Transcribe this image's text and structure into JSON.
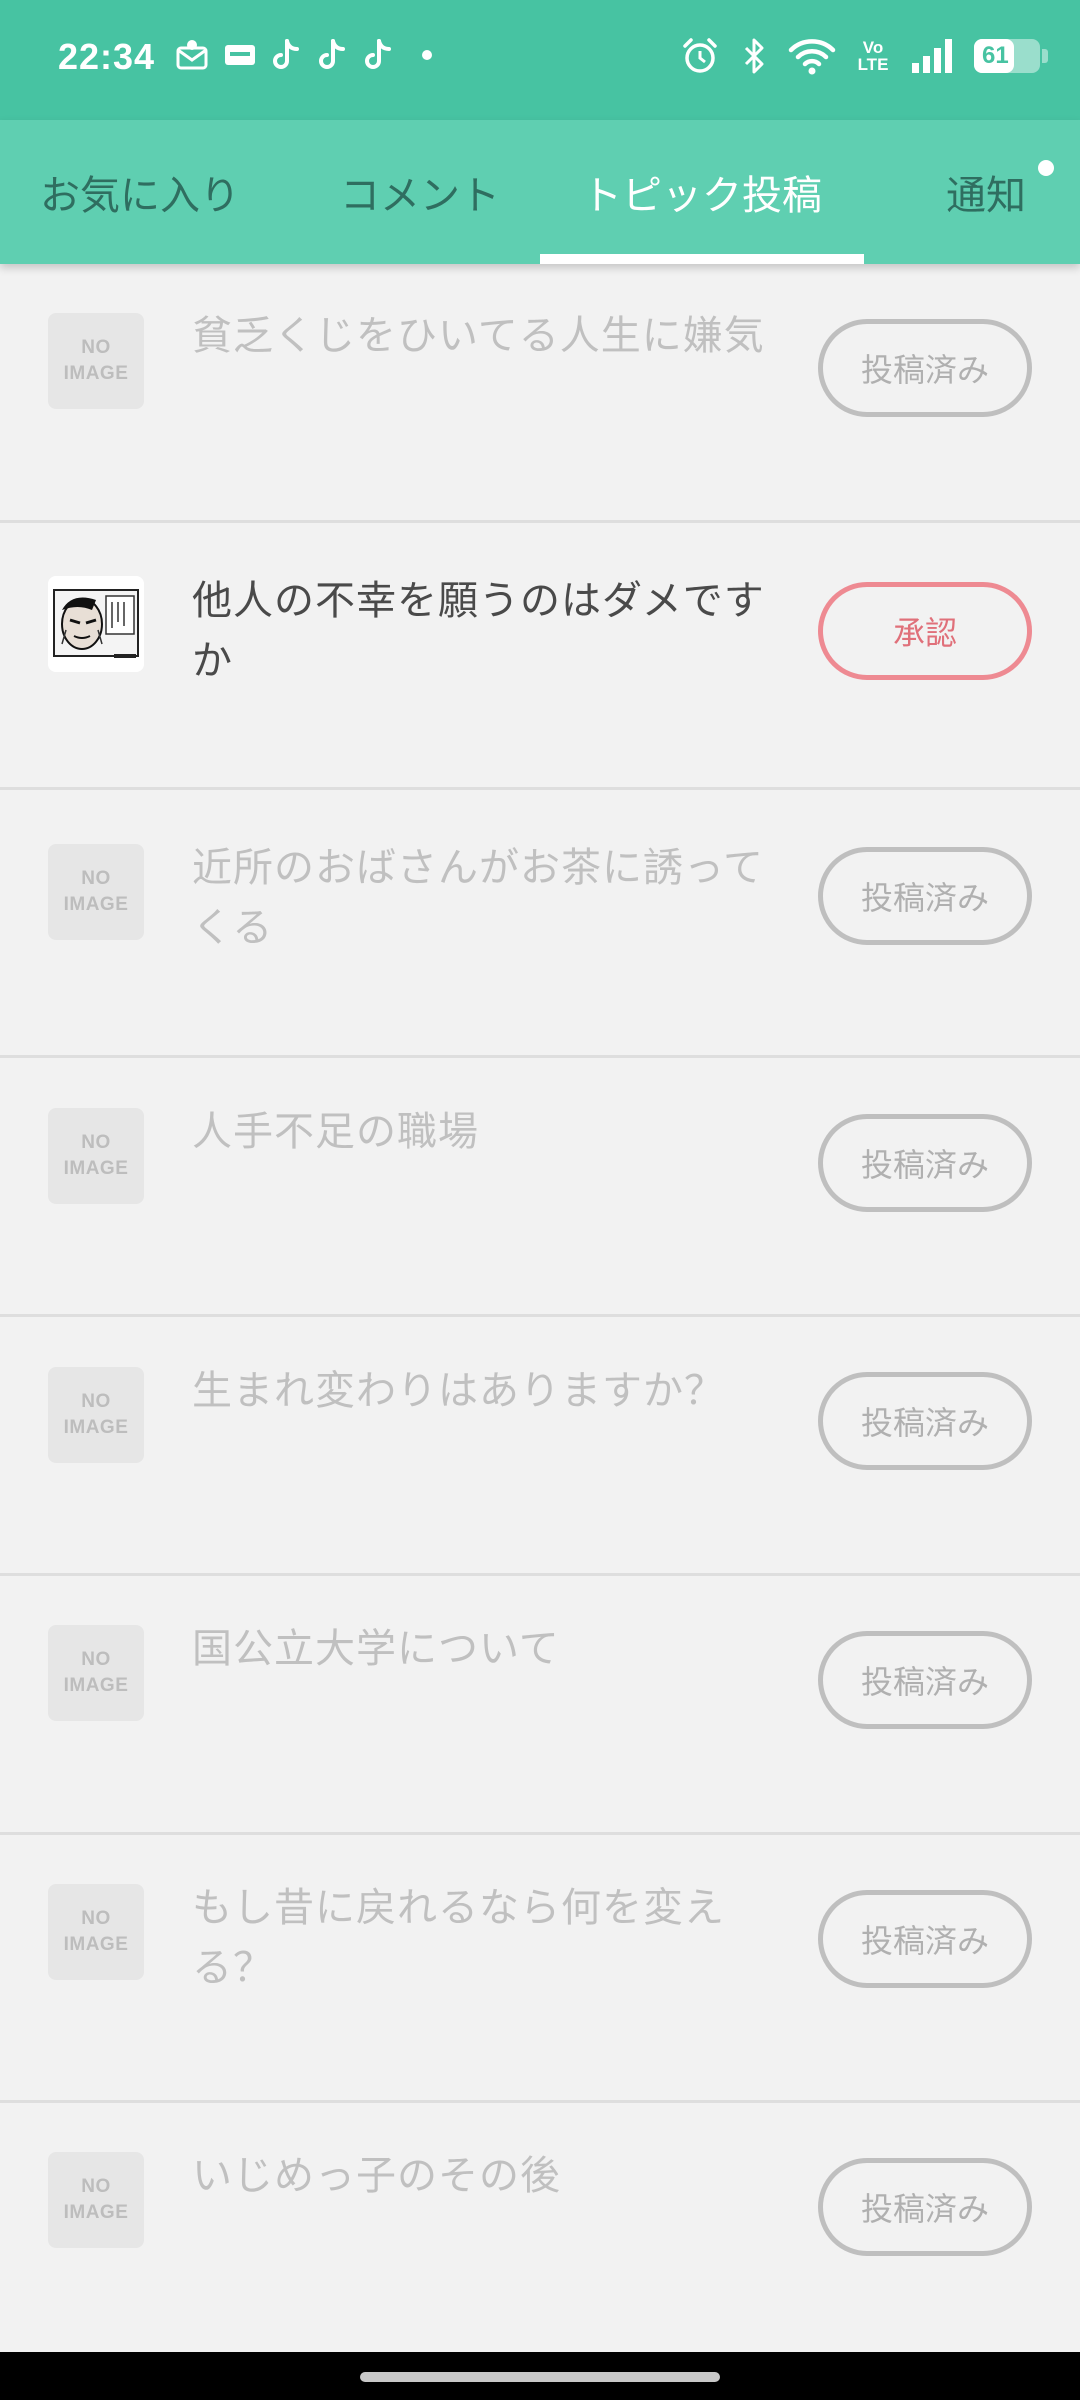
{
  "status_bar": {
    "time": "22:34",
    "notification_icons": [
      "mail-icon",
      "ticket-icon",
      "tiktok-icon",
      "tiktok-icon",
      "tiktok-icon",
      "dot-icon"
    ],
    "system_icons": [
      "alarm-icon",
      "bluetooth-icon",
      "wifi-icon",
      "volte-icon",
      "signal-icon"
    ],
    "volte_text": "Vo LTE",
    "battery_level": "61",
    "battery_fraction": 0.61
  },
  "tabs": [
    {
      "label": "お気に入り",
      "active": false
    },
    {
      "label": "コメント",
      "active": false
    },
    {
      "label": "トピック投稿",
      "active": true
    },
    {
      "label": "通知",
      "active": false,
      "badge_dot": true
    }
  ],
  "no_image": {
    "line1": "NO",
    "line2": "IMAGE"
  },
  "topics": [
    {
      "title": "貧乏くじをひいてる人生に嫌気",
      "status": "投稿済み",
      "thumbnail": "no-image"
    },
    {
      "title": "他人の不幸を願うのはダメですか",
      "status": "承認",
      "thumbnail": "manga-image"
    },
    {
      "title": "近所のおばさんがお茶に誘ってくる",
      "status": "投稿済み",
      "thumbnail": "no-image"
    },
    {
      "title": "人手不足の職場",
      "status": "投稿済み",
      "thumbnail": "no-image"
    },
    {
      "title": "生まれ変わりはありますか？",
      "status": "投稿済み",
      "thumbnail": "no-image"
    },
    {
      "title": "国公立大学について",
      "status": "投稿済み",
      "thumbnail": "no-image"
    },
    {
      "title": "もし昔に戻れるなら何を変える？",
      "status": "投稿済み",
      "thumbnail": "no-image"
    },
    {
      "title": "いじめっ子のその後",
      "status": "投稿済み",
      "thumbnail": "no-image"
    }
  ],
  "colors": {
    "header": "#47c3a2",
    "tabbar": "#5fcfb1",
    "approve": "#ee8a92",
    "posted": "#bfbfbf"
  }
}
